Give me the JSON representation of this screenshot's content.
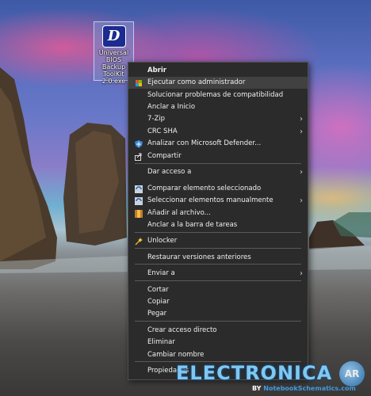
{
  "desktop_icon": {
    "label": "Universal\nBIOS Backup\nToolKit\n2.0.exe",
    "glyph": "D"
  },
  "context_menu": {
    "items": [
      {
        "label": "Abrir",
        "bold": true
      },
      {
        "label": "Ejecutar como administrador",
        "icon": "shield-icon",
        "highlighted": true
      },
      {
        "label": "Solucionar problemas de compatibilidad"
      },
      {
        "label": "Anclar a Inicio"
      },
      {
        "label": "7-Zip",
        "submenu": true
      },
      {
        "label": "CRC SHA",
        "submenu": true
      },
      {
        "label": "Analizar con Microsoft Defender...",
        "icon": "defender-icon"
      },
      {
        "label": "Compartir",
        "icon": "share-icon"
      },
      {
        "label": "Dar acceso a",
        "submenu": true
      },
      {
        "label": "Comparar elemento seleccionado",
        "icon": "compare-icon"
      },
      {
        "label": "Seleccionar elementos manualmente",
        "icon": "compare-icon",
        "submenu": true
      },
      {
        "label": "Añadir al archivo...",
        "icon": "archive-icon"
      },
      {
        "label": "Anclar a la barra de tareas"
      },
      {
        "label": "Unlocker",
        "icon": "wand-icon"
      },
      {
        "label": "Restaurar versiones anteriores"
      },
      {
        "label": "Enviar a",
        "submenu": true
      },
      {
        "label": "Cortar"
      },
      {
        "label": "Copiar"
      },
      {
        "label": "Pegar"
      },
      {
        "label": "Crear acceso directo"
      },
      {
        "label": "Eliminar"
      },
      {
        "label": "Cambiar nombre"
      },
      {
        "label": "Propiedades"
      }
    ],
    "submenu_arrow": "›"
  },
  "watermark": {
    "main": "ELECTRONICA",
    "by": "BY",
    "site": "NotebookSchematics.com",
    "logo": "AR"
  },
  "colors": {
    "menu_bg": "#2b2b2b",
    "menu_text": "#f0f0f0",
    "highlight": "#414141",
    "watermark": "#7fc8f0"
  }
}
